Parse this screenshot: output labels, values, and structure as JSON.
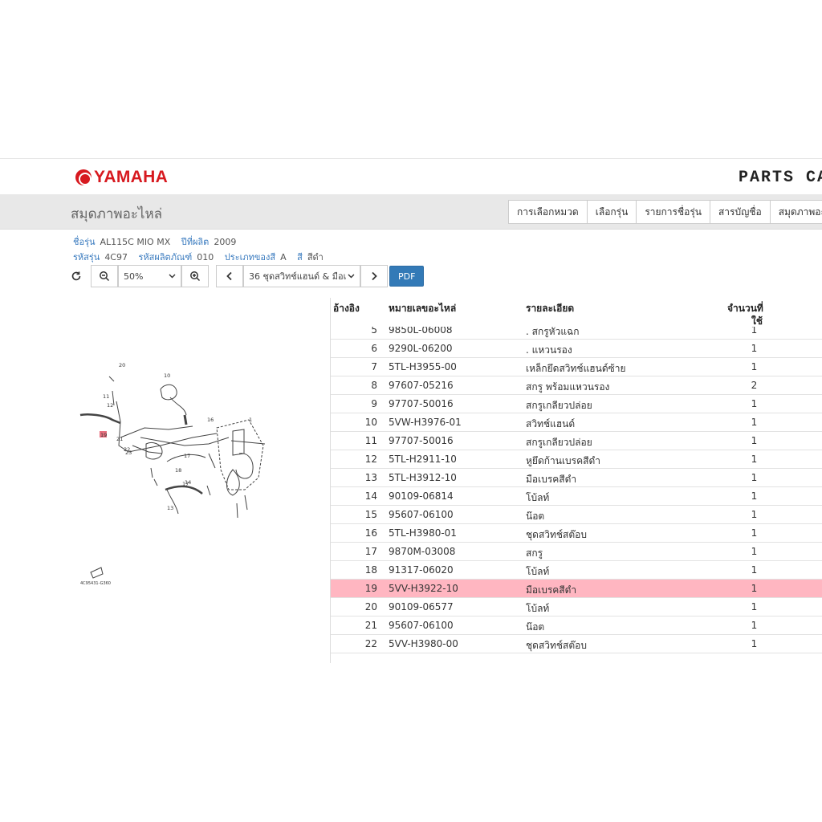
{
  "header": {
    "logo_text": "YAMAHA",
    "brand_title": "PARTS CATA"
  },
  "titlebar": {
    "page_title": "สมุดภาพอะไหล่",
    "tabs": [
      "การเลือกหมวด",
      "เลือกรุ่น",
      "รายการชื่อรุ่น",
      "สารบัญชื่อ",
      "สมุดภาพอะไห"
    ]
  },
  "info": {
    "model_label": "ชื่อรุ่น",
    "model_value": "AL115C MIO MX",
    "year_label": "ปีที่ผลิต",
    "year_value": "2009",
    "code_label": "รหัสรุ่น",
    "code_value": "4C97",
    "product_label": "รหัสผลิตภัณฑ์",
    "product_value": "010",
    "color_type_label": "ประเภทของสี",
    "color_type_value": "A",
    "color_label": "สี",
    "color_value": "สีดำ"
  },
  "toolbar": {
    "zoom_value": "50%",
    "section_value": "36 ชุดสวิทช์แฮนด์ & มือเ",
    "pdf_label": "PDF"
  },
  "diagram": {
    "caption": "4C95431-G360",
    "callouts": [
      "20",
      "10",
      "11",
      "12",
      "19",
      "21",
      "22",
      "17",
      "13",
      "14",
      "18",
      "17",
      "1",
      "23",
      "16"
    ]
  },
  "table": {
    "headers": {
      "ref": "อ้างอิง",
      "part": "หมายเลขอะไหล่",
      "desc": "รายละเอียด",
      "qty_line1": "จำนวนที่",
      "qty_line2": "ใช้"
    },
    "rows": [
      {
        "ref": "5",
        "part": "9850L-06008",
        "desc": ". สกรูหัวแฉก",
        "qty": "1",
        "highlight": false
      },
      {
        "ref": "6",
        "part": "9290L-06200",
        "desc": ". แหวนรอง",
        "qty": "1",
        "highlight": false
      },
      {
        "ref": "7",
        "part": "5TL-H3955-00",
        "desc": "เหล็กยึดสวิทช์แฮนด์ซ้าย",
        "qty": "1",
        "highlight": false
      },
      {
        "ref": "8",
        "part": "97607-05216",
        "desc": "สกรู พร้อมแหวนรอง",
        "qty": "2",
        "highlight": false
      },
      {
        "ref": "9",
        "part": "97707-50016",
        "desc": "สกรูเกลียวปล่อย",
        "qty": "1",
        "highlight": false
      },
      {
        "ref": "10",
        "part": "5VW-H3976-01",
        "desc": "สวิทช์แฮนด์",
        "qty": "1",
        "highlight": false
      },
      {
        "ref": "11",
        "part": "97707-50016",
        "desc": "สกรูเกลียวปล่อย",
        "qty": "1",
        "highlight": false
      },
      {
        "ref": "12",
        "part": "5TL-H2911-10",
        "desc": "หูยึดก้านเบรคสีดำ",
        "qty": "1",
        "highlight": false
      },
      {
        "ref": "13",
        "part": "5TL-H3912-10",
        "desc": "มือเบรคสีดำ",
        "qty": "1",
        "highlight": false
      },
      {
        "ref": "14",
        "part": "90109-06814",
        "desc": "โบ้ลท์",
        "qty": "1",
        "highlight": false
      },
      {
        "ref": "15",
        "part": "95607-06100",
        "desc": "น๊อต",
        "qty": "1",
        "highlight": false
      },
      {
        "ref": "16",
        "part": "5TL-H3980-01",
        "desc": "ชุดสวิทช์สต๊อบ",
        "qty": "1",
        "highlight": false
      },
      {
        "ref": "17",
        "part": "9870M-03008",
        "desc": "สกรู",
        "qty": "1",
        "highlight": false
      },
      {
        "ref": "18",
        "part": "91317-06020",
        "desc": "โบ้ลท์",
        "qty": "1",
        "highlight": false
      },
      {
        "ref": "19",
        "part": "5VV-H3922-10",
        "desc": "มือเบรคสีดำ",
        "qty": "1",
        "highlight": true
      },
      {
        "ref": "20",
        "part": "90109-06577",
        "desc": "โบ้ลท์",
        "qty": "1",
        "highlight": false
      },
      {
        "ref": "21",
        "part": "95607-06100",
        "desc": "น๊อต",
        "qty": "1",
        "highlight": false
      },
      {
        "ref": "22",
        "part": "5VV-H3980-00",
        "desc": "ชุดสวิทช์สต๊อบ",
        "qty": "1",
        "highlight": false
      }
    ]
  },
  "colors": {
    "brand_red": "#d7191f",
    "highlight_row": "#ffb6c1",
    "pdf_button": "#337ab7",
    "label_blue": "#3a7bbf"
  }
}
